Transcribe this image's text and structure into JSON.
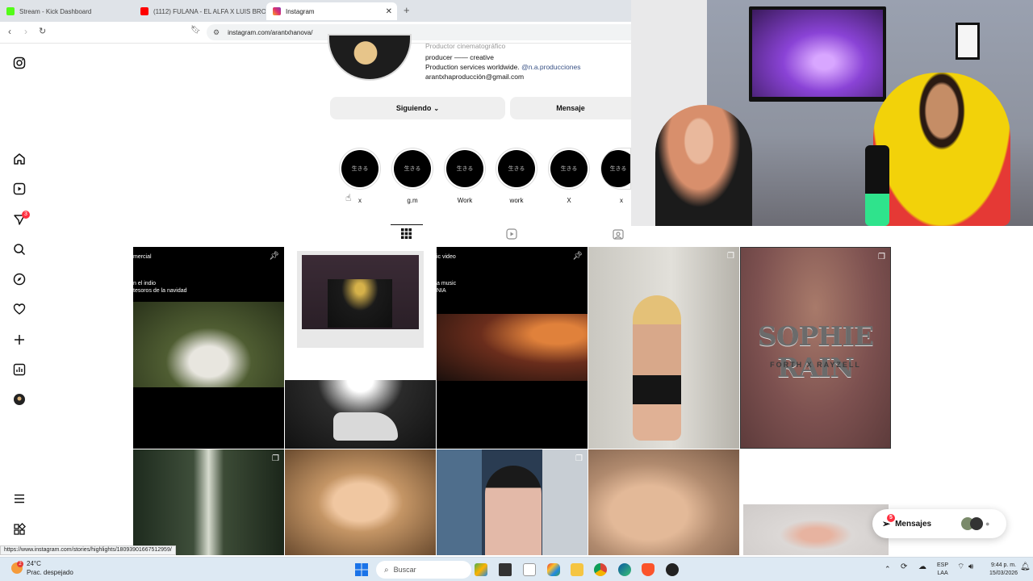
{
  "browser": {
    "tabs": [
      {
        "title": "Stream - Kick Dashboard",
        "color": "#53fc18"
      },
      {
        "title": "(1112) FULANA - EL ALFA X LUIS BRO",
        "color": "#ff0000"
      },
      {
        "title": "Instagram",
        "color": "#e1306c"
      }
    ],
    "url": "instagram.com/arantxhanova/"
  },
  "profile": {
    "category": "Productor cinematográfico",
    "bio_line1": "producer —— creative",
    "bio_line2_prefix": "Production services worldwide.",
    "bio_mention": "@n.a.producciones",
    "email": "arantxhaproducción@gmail.com",
    "following_label": "Siguiendo",
    "message_label": "Mensaje"
  },
  "highlights": [
    {
      "cover": "生きる",
      "label": "x"
    },
    {
      "cover": "生きる",
      "label": "g.m"
    },
    {
      "cover": "生きる",
      "label": "Work"
    },
    {
      "cover": "生きる",
      "label": "work"
    },
    {
      "cover": "生きる",
      "label": "X"
    },
    {
      "cover": "生きる",
      "label": "x"
    }
  ],
  "posts": {
    "post1": {
      "line1": "mercial",
      "line2": "n el indio",
      "line3": "tesoros de la navidad"
    },
    "post3": {
      "line1": "ic video",
      "line2": "a music",
      "line3": "NIA"
    },
    "post5": {
      "title": "SOPHIE RAIN",
      "subtitle": "FORTH X RAYZELL"
    }
  },
  "messages": {
    "label": "Mensajes",
    "badge": "5"
  },
  "nav_badge": "3",
  "status_url": "https://www.instagram.com/stories/highlights/18093901667512959/",
  "taskbar": {
    "weather_temp": "24°C",
    "weather_desc": "Prac. despejado",
    "search_placeholder": "Buscar",
    "lang": "ESP",
    "lang2": "LAA",
    "time": "9:44 p. m.",
    "date": "15/03/2026"
  },
  "colors": {
    "accent": "#0095f6",
    "notification": "#ff3040"
  }
}
